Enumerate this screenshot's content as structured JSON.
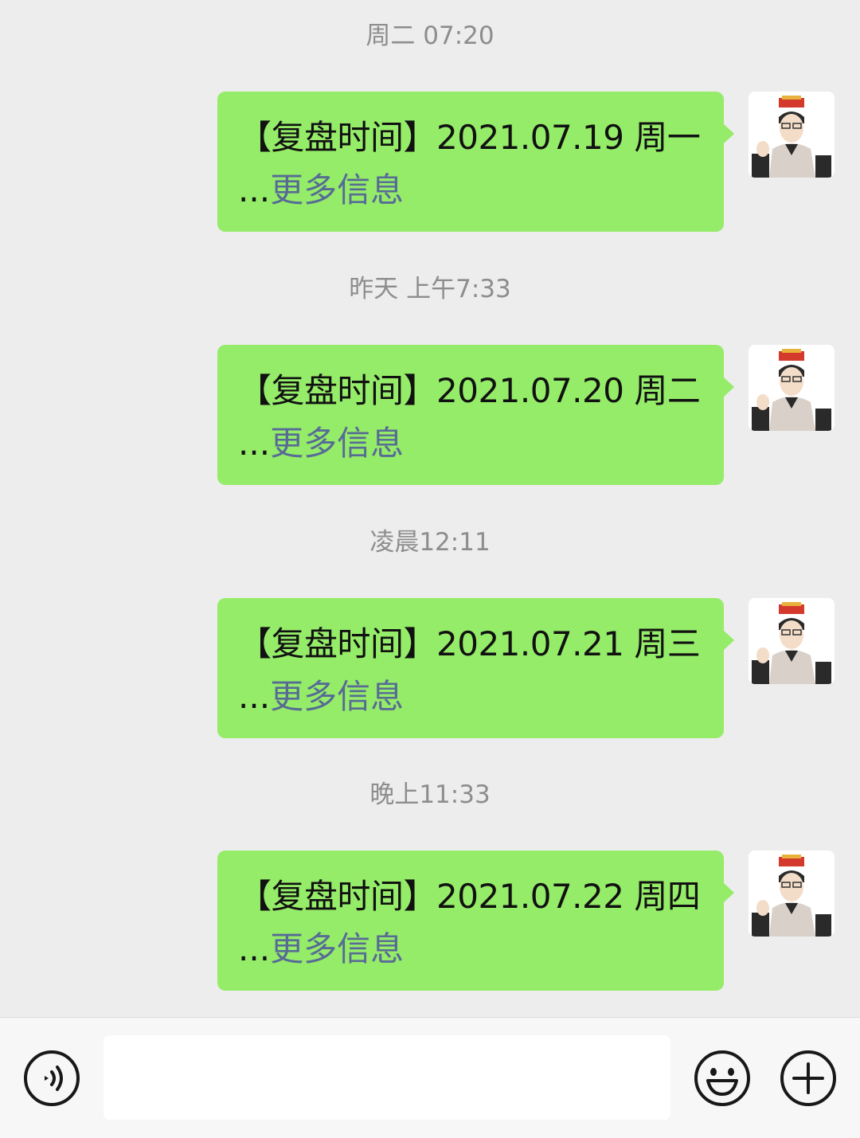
{
  "messages": [
    {
      "timestamp": "周二 07:20",
      "title": "【复盘时间】2021.07.19 周一",
      "ellipsis": "...",
      "more": "更多信息"
    },
    {
      "timestamp": "昨天 上午7:33",
      "title": "【复盘时间】2021.07.20 周二",
      "ellipsis": "...",
      "more": "更多信息"
    },
    {
      "timestamp": "凌晨12:11",
      "title": "【复盘时间】2021.07.21 周三",
      "ellipsis": "...",
      "more": "更多信息"
    },
    {
      "timestamp": "晚上11:33",
      "title": "【复盘时间】2021.07.22 周四",
      "ellipsis": "...",
      "more": "更多信息"
    }
  ],
  "input_bar": {
    "message_value": "",
    "voice_icon": "voice-icon",
    "emoji_icon": "emoji-icon",
    "plus_icon": "plus-icon"
  },
  "colors": {
    "background": "#ededed",
    "bubble": "#95ec69",
    "link": "#576b95",
    "timestamp": "#8d8d8d"
  }
}
